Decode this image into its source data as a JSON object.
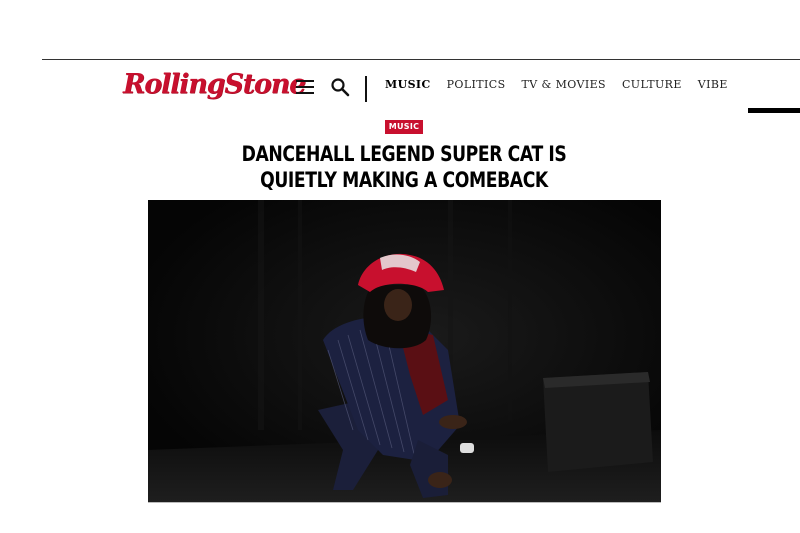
{
  "brand": {
    "logo_text": "RollingStone",
    "color": "#c8102e"
  },
  "header": {
    "menu_icon": "hamburger-menu-icon",
    "search_icon": "search-icon",
    "nav": [
      {
        "label": "MUSIC",
        "active": true
      },
      {
        "label": "POLITICS"
      },
      {
        "label": "TV & MOVIES"
      },
      {
        "label": "CULTURE"
      },
      {
        "label": "VIBE"
      }
    ]
  },
  "article": {
    "category": "MUSIC",
    "headline_line1": "DANCEHALL LEGEND SUPER CAT IS",
    "headline_line2": "QUIETLY MAKING A COMEBACK",
    "hero_image_subject": "man in pinstripe suit and red bandana crouching on dark stage"
  }
}
